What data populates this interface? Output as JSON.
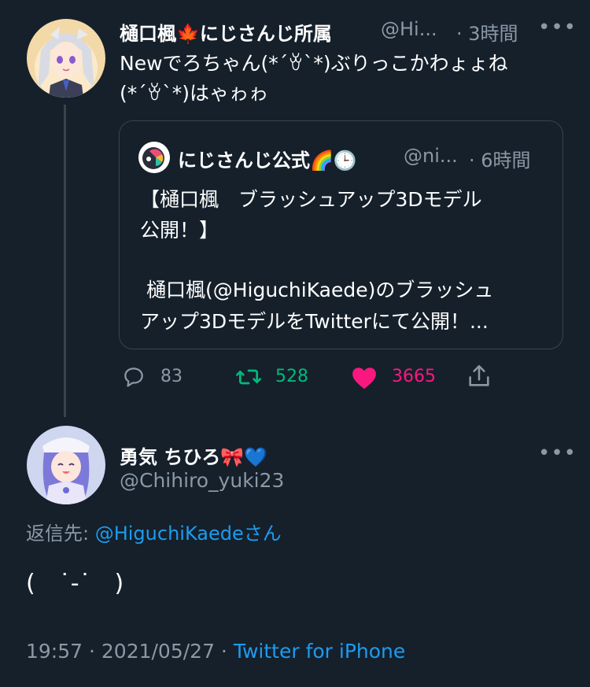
{
  "tweet": {
    "author_name": "樋口楓🍁にじさんじ所属",
    "author_handle": "@Hi...",
    "time": "· 3時間",
    "text_line1": "Newでろちゃん(*´ꈊ`*)ぶりっこかわょょね",
    "text_line2": "(*´ꈊ`*)はゃゎゎ",
    "more_icon": "more-dots-icon",
    "quote": {
      "author_name": "にじさんじ公式🌈🕒",
      "author_handle": "@ni...",
      "time": "· 6時間",
      "line1": "【樋口楓　ブラッシュアップ3Dモデル",
      "line2": "公開！】",
      "line3": " 樋口楓(@HiguchiKaede)のブラッシュ",
      "line4": "アップ3DモデルをTwitterにて公開！..."
    },
    "actions": {
      "reply_count": "83",
      "retweet_count": "528",
      "like_count": "3665"
    }
  },
  "reply": {
    "author_name": "勇気 ちひろ🎀💙",
    "author_handle": "@Chihiro_yuki23",
    "reply_to_prefix": "返信先: ",
    "reply_to_handle": "@HiguchiKaede",
    "reply_to_suffix": "さん",
    "text": "(　˙-˙　)",
    "timestamp": "19:57 · 2021/05/27 · ",
    "source": "Twitter for iPhone"
  },
  "colors": {
    "background": "#15202b",
    "muted": "#8b98a5",
    "link": "#1d9bf0",
    "retweet": "#00ba7c",
    "like": "#f91880",
    "border": "#38444d"
  }
}
